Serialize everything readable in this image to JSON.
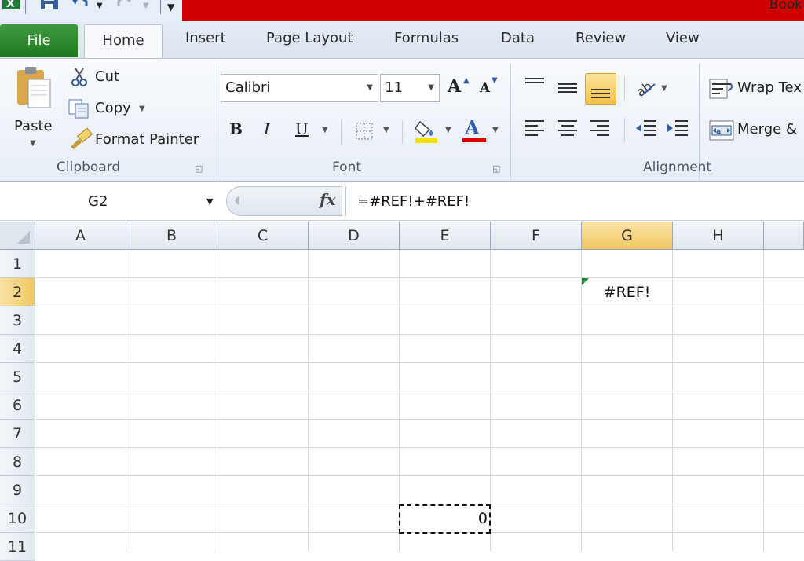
{
  "titlebar": {
    "title": "Book"
  },
  "tabs": {
    "file": "File",
    "home": "Home",
    "insert": "Insert",
    "page_layout": "Page Layout",
    "formulas": "Formulas",
    "data": "Data",
    "review": "Review",
    "view": "View"
  },
  "clipboard": {
    "paste": "Paste",
    "cut": "Cut",
    "copy": "Copy",
    "format_painter": "Format Painter",
    "group": "Clipboard"
  },
  "font": {
    "name": "Calibri",
    "size": "11",
    "bold": "B",
    "italic": "I",
    "underline": "U",
    "grow": "A",
    "shrink": "A",
    "font_color_letter": "A",
    "group": "Font"
  },
  "alignment": {
    "wrap_text": "Wrap Tex",
    "merge": "Merge &",
    "group": "Alignment"
  },
  "formula_bar": {
    "name_box": "G2",
    "fx": "fx",
    "formula": "=#REF!+#REF!"
  },
  "columns": [
    "A",
    "B",
    "C",
    "D",
    "E",
    "F",
    "G",
    "H"
  ],
  "rows": [
    "1",
    "2",
    "3",
    "4",
    "5",
    "6",
    "7",
    "8",
    "9",
    "10",
    "11"
  ],
  "cells": {
    "G2": "#REF!",
    "E10": "0"
  },
  "colors": {
    "title_red": "#d20000",
    "file_tab": "#2a862a",
    "selected_header": "#f2c663",
    "error_indicator": "#1e8a2a"
  },
  "icons": [
    "excel-icon",
    "save-icon",
    "undo-icon",
    "redo-icon",
    "customize-icon",
    "paste-icon",
    "cut-icon",
    "copy-icon",
    "format-painter-icon",
    "borders-icon",
    "fill-color-icon",
    "font-color-icon",
    "align-top-icon",
    "align-middle-icon",
    "align-bottom-icon",
    "orientation-icon",
    "align-left-icon",
    "align-center-icon",
    "align-right-icon",
    "decrease-indent-icon",
    "increase-indent-icon",
    "wrap-text-icon",
    "merge-icon"
  ]
}
